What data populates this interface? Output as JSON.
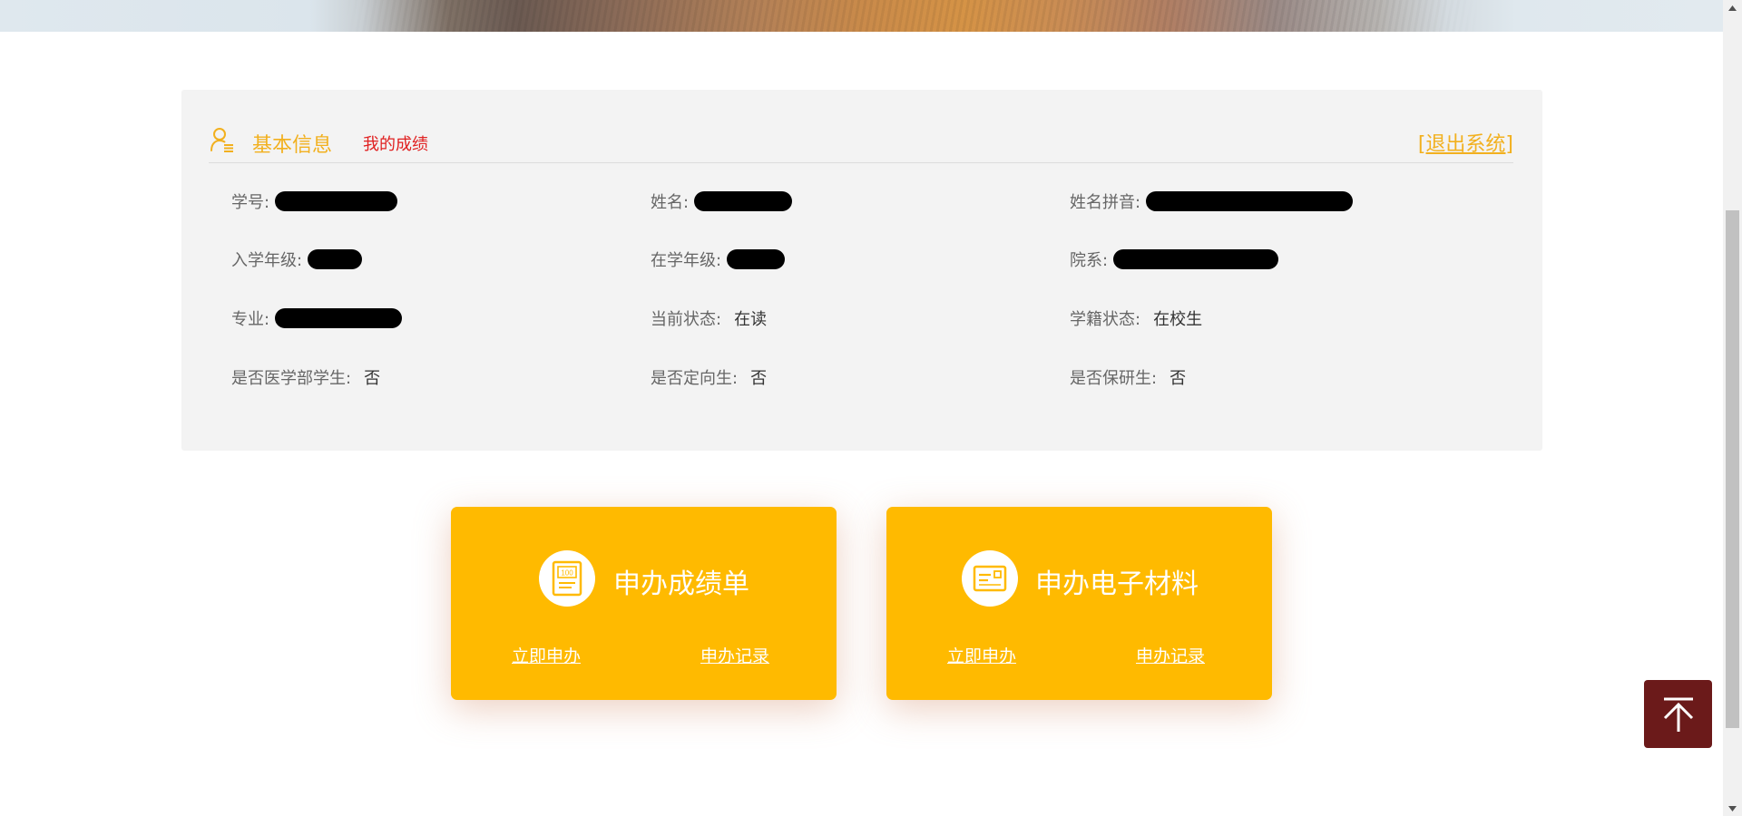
{
  "header": {
    "tab_basic": "基本信息",
    "tab_scores": "我的成绩",
    "logout": "[退出系统]"
  },
  "fields": {
    "student_id_label": "学号:",
    "name_label": "姓名:",
    "name_pinyin_label": "姓名拼音:",
    "entry_grade_label": "入学年级:",
    "current_grade_label": "在学年级:",
    "department_label": "院系:",
    "major_label": "专业:",
    "current_status_label": "当前状态:",
    "current_status_value": "在读",
    "enrollment_status_label": "学籍状态:",
    "enrollment_status_value": "在校生",
    "medical_label": "是否医学部学生:",
    "medical_value": "否",
    "directed_label": "是否定向生:",
    "directed_value": "否",
    "recommended_label": "是否保研生:",
    "recommended_value": "否"
  },
  "cards": [
    {
      "title": "申办成绩单",
      "icon": "transcript-100-icon",
      "apply_link": "立即申办",
      "record_link": "申办记录"
    },
    {
      "title": "申办电子材料",
      "icon": "electronic-document-icon",
      "apply_link": "立即申办",
      "record_link": "申办记录"
    }
  ],
  "colors": {
    "accent": "#ffba00",
    "header_accent": "#f2b01e",
    "scores_tab": "#e02020",
    "back_top": "#6b1a1a",
    "panel_bg": "#f3f3f3"
  },
  "back_to_top_icon": "arrow-up-to-top-icon"
}
